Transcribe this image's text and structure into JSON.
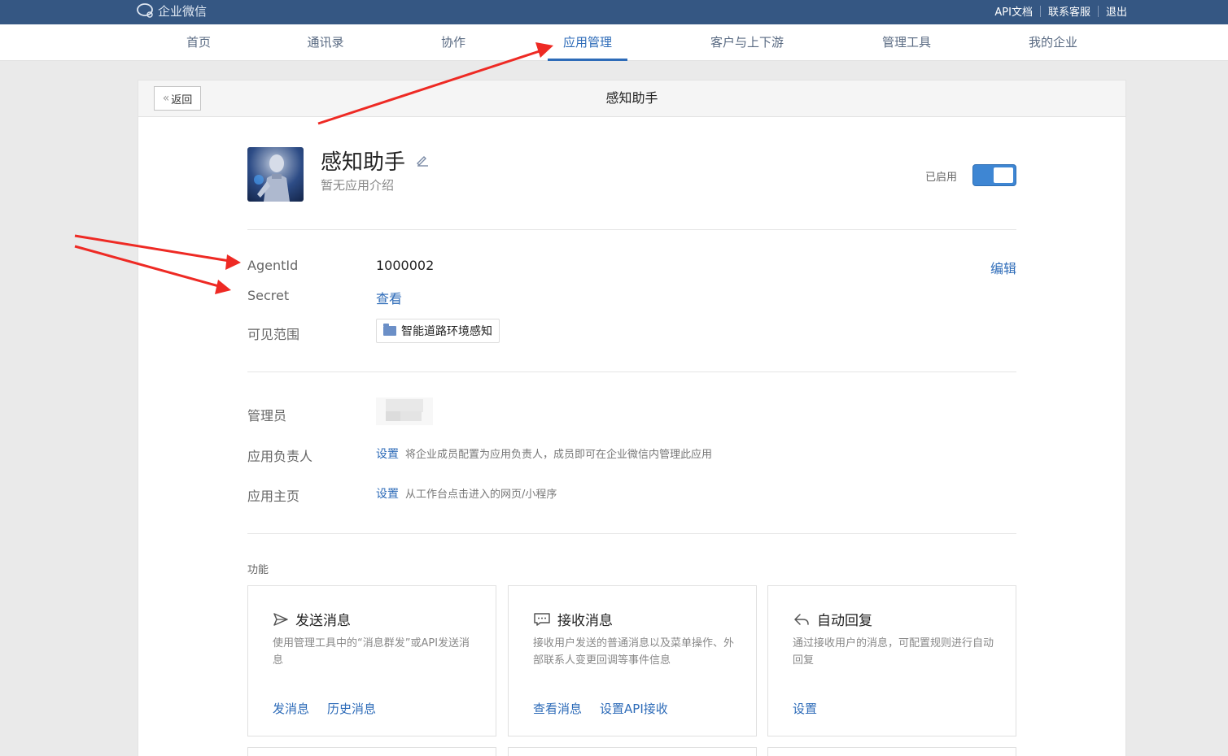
{
  "topbar": {
    "logo_text": "企业微信",
    "links": [
      "API文档",
      "联系客服",
      "退出"
    ]
  },
  "nav": {
    "items": [
      "首页",
      "通讯录",
      "协作",
      "应用管理",
      "客户与上下游",
      "管理工具",
      "我的企业"
    ],
    "active": "应用管理"
  },
  "page": {
    "back_label": "返回",
    "title": "感知助手"
  },
  "app": {
    "name": "感知助手",
    "description": "暂无应用介绍",
    "status_label": "已启用",
    "enabled": true
  },
  "details": {
    "agentid_label": "AgentId",
    "agentid_value": "1000002",
    "edit_label": "编辑",
    "secret_label": "Secret",
    "secret_action": "查看",
    "scope_label": "可见范围",
    "scope_value": "智能道路环境感知"
  },
  "management": {
    "admin_label": "管理员",
    "owner_label": "应用负责人",
    "owner_action": "设置",
    "owner_note": "将企业成员配置为应用负责人，成员即可在企业微信内管理此应用",
    "homepage_label": "应用主页",
    "homepage_action": "设置",
    "homepage_note": "从工作台点击进入的网页/小程序"
  },
  "features": {
    "section_title": "功能",
    "cards": [
      {
        "icon": "send-icon",
        "title": "发送消息",
        "desc": "使用管理工具中的“消息群发”或API发送消息",
        "links": [
          "发消息",
          "历史消息"
        ]
      },
      {
        "icon": "message-icon",
        "title": "接收消息",
        "desc": "接收用户发送的普通消息以及菜单操作、外部联系人变更回调等事件信息",
        "links": [
          "查看消息",
          "设置API接收"
        ]
      },
      {
        "icon": "reply-icon",
        "title": "自动回复",
        "desc": "通过接收用户的消息，可配置规则进行自动回复",
        "links": [
          "设置"
        ]
      }
    ]
  },
  "colors": {
    "topbar": "#355783",
    "accent": "#2d6bb8",
    "toggle": "#3e86d3",
    "annotation_arrow": "#ee2a24"
  }
}
